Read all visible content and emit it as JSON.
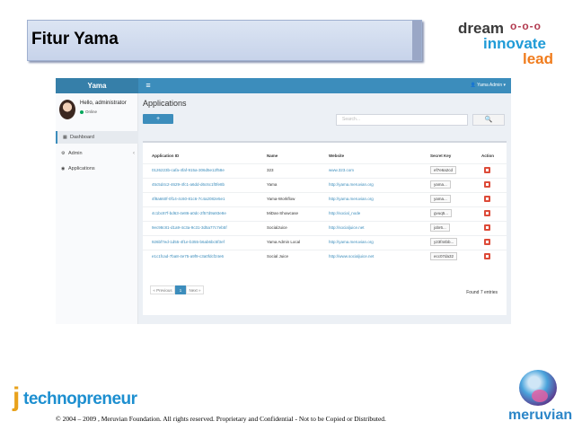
{
  "slide": {
    "title": "Fitur Yama",
    "copyright": "© 2004 – 2009 , Meruvian Foundation. All rights reserved. Proprietary and Confidential - Not to be Copied or Distributed."
  },
  "logos": {
    "top_right": {
      "line1": "dream",
      "dots": "o-o-o",
      "line2": "innovate",
      "line3": "lead"
    },
    "bottom_left": {
      "j": "j",
      "word": "technopreneur"
    },
    "bottom_right": {
      "word": "meruvian"
    }
  },
  "app": {
    "brand": "Yama",
    "menu_toggle": "≡",
    "user_menu": "👤 Yama Admin ▾",
    "sidebar": {
      "greeting": "Hello, administrator",
      "status": "Online",
      "items": [
        {
          "icon": "▦",
          "label": "Dashboard",
          "active": true
        },
        {
          "icon": "⚙",
          "label": "Admin",
          "caret": "‹"
        },
        {
          "icon": "◉",
          "label": "Applications"
        }
      ]
    },
    "page_title": "Applications",
    "add_button": "+",
    "search": {
      "placeholder": "Search...",
      "button": "🔍"
    },
    "table": {
      "headers": [
        "Application ID",
        "Name",
        "Website",
        "Secret Key",
        "Action"
      ],
      "rows": [
        {
          "id": "0126223b-cafa-4faf-915a-306d5e12f58e",
          "name": "323",
          "website": "www.323.com",
          "key": "ef7e6a2cd"
        },
        {
          "id": "45c5d4c2-4629-4fc1-a6dd-d6c6c1f0fe8b",
          "name": "Yama",
          "website": "http://yama.meruvian.org",
          "key": "yama..."
        },
        {
          "id": "4f8a660f-0f14-4c60-81c6-7c4a2082e5e1",
          "name": "Yama-Workflow",
          "website": "http://yama.meruvian.org",
          "key": "yama..."
        },
        {
          "id": "4c1bc87f-bd63-4e86-a0dc-2f57d9a93e8e",
          "name": "MiDas-Showcase",
          "website": "http://social_node",
          "key": "gvuq5..."
        },
        {
          "id": "9ec98c81-d1a9-4c3a-9c31-3d5a77c7eb5f",
          "name": "SocialJuice",
          "website": "http://socialjuice.net",
          "key": "jobr6..."
        },
        {
          "id": "926bf7ed-1d55-4f1e-b355-b6ab6bc5f3ef",
          "name": "Yama Admin Local",
          "website": "http://yama.meruvian.org",
          "key": "y23f44bb..."
        },
        {
          "id": "e1c1fcad-7ba8-4e75-a9f9-c3a0fdcf24e6",
          "name": "Social Juice",
          "website": "http://www.socialjuice.net",
          "key": "ecc07da32"
        }
      ]
    },
    "pager": {
      "prev": "« Previous",
      "current": "1",
      "next": "Next »"
    },
    "found": "Found 7 entries"
  }
}
